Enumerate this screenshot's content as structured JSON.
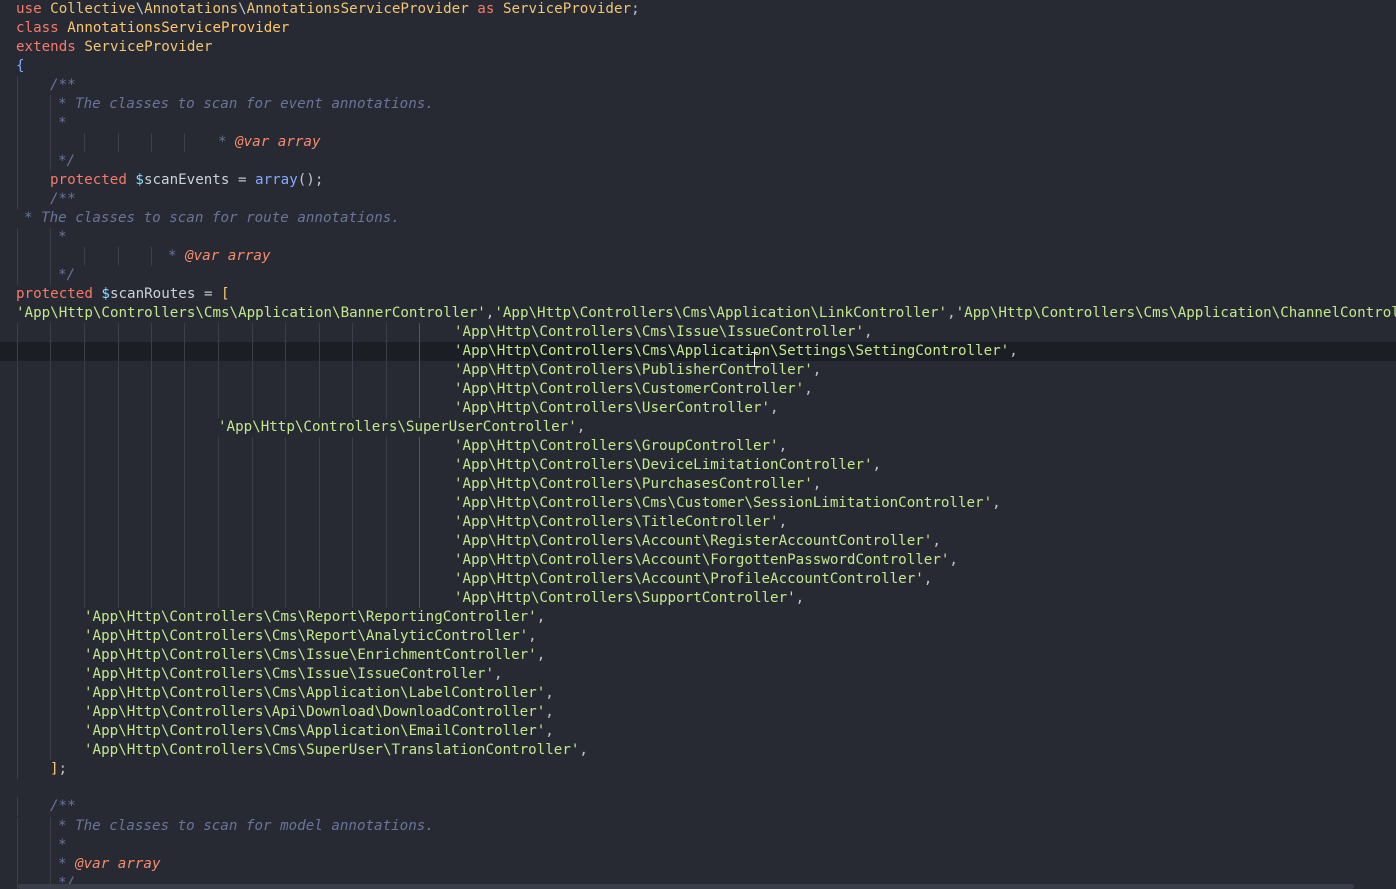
{
  "editor": {
    "lines": [
      [
        [
          "kw",
          "use"
        ],
        [
          "txt",
          " "
        ],
        [
          "cls",
          "Collective"
        ],
        [
          "pun",
          "\\"
        ],
        [
          "cls",
          "Annotations"
        ],
        [
          "pun",
          "\\"
        ],
        [
          "cls",
          "AnnotationsServiceProvider"
        ],
        [
          "txt",
          " "
        ],
        [
          "kw",
          "as"
        ],
        [
          "txt",
          " "
        ],
        [
          "cls",
          "ServiceProvider"
        ],
        [
          "pun",
          ";"
        ]
      ],
      [
        [
          "kw",
          "class"
        ],
        [
          "txt",
          " "
        ],
        [
          "clsd",
          "AnnotationsServiceProvider"
        ]
      ],
      [
        [
          "kw",
          "extends"
        ],
        [
          "txt",
          " "
        ],
        [
          "cls",
          "ServiceProvider"
        ]
      ],
      [
        [
          "bkt",
          "{"
        ]
      ],
      [
        [
          "com",
          "/**"
        ]
      ],
      [
        [
          "com",
          "* The classes to scan for event annotations."
        ]
      ],
      [
        [
          "com",
          "*"
        ]
      ],
      [
        [
          "com",
          "* "
        ],
        [
          "tag",
          "@var array"
        ]
      ],
      [
        [
          "com",
          "*/"
        ]
      ],
      [
        [
          "kw",
          "protected"
        ],
        [
          "txt",
          " "
        ],
        [
          "var",
          "$"
        ],
        [
          "txt",
          "scanEvents"
        ],
        [
          "txt",
          " "
        ],
        [
          "pun",
          "="
        ],
        [
          "txt",
          " "
        ],
        [
          "fn",
          "array"
        ],
        [
          "pun",
          "();"
        ]
      ],
      [
        [
          "com",
          "/**"
        ]
      ],
      [
        [
          "com",
          "* The classes to scan for route annotations."
        ]
      ],
      [
        [
          "com",
          "*"
        ]
      ],
      [
        [
          "com",
          "* "
        ],
        [
          "tag",
          "@var array"
        ]
      ],
      [
        [
          "com",
          "*/"
        ]
      ],
      [
        [
          "kw",
          "protected"
        ],
        [
          "txt",
          " "
        ],
        [
          "var",
          "$"
        ],
        [
          "txt",
          "scanRoutes"
        ],
        [
          "txt",
          " "
        ],
        [
          "pun",
          "="
        ],
        [
          "txt",
          " "
        ],
        [
          "brk",
          "["
        ]
      ],
      [
        [
          "str",
          "'App\\Http\\Controllers\\Cms\\Application\\BannerController'"
        ],
        [
          "pun",
          ","
        ],
        [
          "str",
          "'App\\Http\\Controllers\\Cms\\Application\\LinkController'"
        ],
        [
          "pun",
          ","
        ],
        [
          "str",
          "'App\\Http\\Controllers\\Cms\\Application\\ChannelController'"
        ]
      ],
      [
        [
          "str",
          "'App\\Http\\Controllers\\Cms\\Issue\\IssueController'"
        ],
        [
          "pun",
          ","
        ]
      ],
      [
        [
          "str",
          "'App\\Http\\Controllers\\Cms\\Application\\Settings\\SettingController'"
        ],
        [
          "pun",
          ","
        ]
      ],
      [
        [
          "str",
          "'App\\Http\\Controllers\\PublisherController'"
        ],
        [
          "pun",
          ","
        ]
      ],
      [
        [
          "str",
          "'App\\Http\\Controllers\\CustomerController'"
        ],
        [
          "pun",
          ","
        ]
      ],
      [
        [
          "str",
          "'App\\Http\\Controllers\\UserController'"
        ],
        [
          "pun",
          ","
        ]
      ],
      [
        [
          "str",
          "'App\\Http\\Controllers\\SuperUserController'"
        ],
        [
          "pun",
          ","
        ]
      ],
      [
        [
          "str",
          "'App\\Http\\Controllers\\GroupController'"
        ],
        [
          "pun",
          ","
        ]
      ],
      [
        [
          "str",
          "'App\\Http\\Controllers\\DeviceLimitationController'"
        ],
        [
          "pun",
          ","
        ]
      ],
      [
        [
          "str",
          "'App\\Http\\Controllers\\PurchasesController'"
        ],
        [
          "pun",
          ","
        ]
      ],
      [
        [
          "str",
          "'App\\Http\\Controllers\\Cms\\Customer\\SessionLimitationController'"
        ],
        [
          "pun",
          ","
        ]
      ],
      [
        [
          "str",
          "'App\\Http\\Controllers\\TitleController'"
        ],
        [
          "pun",
          ","
        ]
      ],
      [
        [
          "str",
          "'App\\Http\\Controllers\\Account\\RegisterAccountController'"
        ],
        [
          "pun",
          ","
        ]
      ],
      [
        [
          "str",
          "'App\\Http\\Controllers\\Account\\ForgottenPasswordController'"
        ],
        [
          "pun",
          ","
        ]
      ],
      [
        [
          "str",
          "'App\\Http\\Controllers\\Account\\ProfileAccountController'"
        ],
        [
          "pun",
          ","
        ]
      ],
      [
        [
          "str",
          "'App\\Http\\Controllers\\SupportController'"
        ],
        [
          "pun",
          ","
        ]
      ],
      [
        [
          "str",
          "'App\\Http\\Controllers\\Cms\\Report\\ReportingController'"
        ],
        [
          "pun",
          ","
        ]
      ],
      [
        [
          "str",
          "'App\\Http\\Controllers\\Cms\\Report\\AnalyticController'"
        ],
        [
          "pun",
          ","
        ]
      ],
      [
        [
          "str",
          "'App\\Http\\Controllers\\Cms\\Issue\\EnrichmentController'"
        ],
        [
          "pun",
          ","
        ]
      ],
      [
        [
          "str",
          "'App\\Http\\Controllers\\Cms\\Issue\\IssueController'"
        ],
        [
          "pun",
          ","
        ]
      ],
      [
        [
          "str",
          "'App\\Http\\Controllers\\Cms\\Application\\LabelController'"
        ],
        [
          "pun",
          ","
        ]
      ],
      [
        [
          "str",
          "'App\\Http\\Controllers\\Api\\Download\\DownloadController'"
        ],
        [
          "pun",
          ","
        ]
      ],
      [
        [
          "str",
          "'App\\Http\\Controllers\\Cms\\Application\\EmailController'"
        ],
        [
          "pun",
          ","
        ]
      ],
      [
        [
          "str",
          "'App\\Http\\Controllers\\Cms\\SuperUser\\TranslationController'"
        ],
        [
          "pun",
          ","
        ]
      ],
      [
        [
          "brk",
          "]"
        ],
        [
          "pun",
          ";"
        ]
      ],
      [],
      [
        [
          "com",
          "/**"
        ]
      ],
      [
        [
          "com",
          "* The classes to scan for model annotations."
        ]
      ],
      [
        [
          "com",
          "*"
        ]
      ],
      [
        [
          "com",
          "* "
        ],
        [
          "tag",
          "@var array"
        ]
      ],
      [
        [
          "com",
          "*/"
        ]
      ]
    ]
  }
}
